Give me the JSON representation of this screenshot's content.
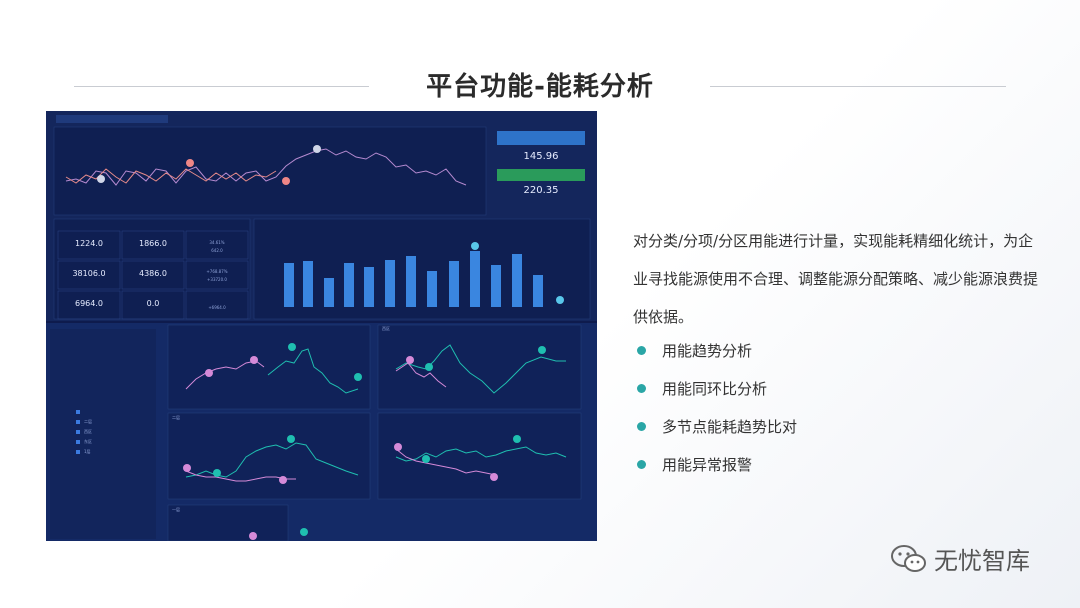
{
  "page": {
    "title": "平台功能-能耗分析"
  },
  "description": "对分类/分项/分区用能进行计量，实现能耗精细化统计，为企业寻找能源使用不合理、调整能源分配策略、减少能源浪费提供依据。",
  "bullets": [
    {
      "label": "用能趋势分析"
    },
    {
      "label": "用能同环比分析"
    },
    {
      "label": "多节点能耗趋势比对"
    },
    {
      "label": "用能异常报警"
    }
  ],
  "brand": {
    "label": "无忧智库"
  },
  "screenshot": {
    "side_values": [
      "145.96",
      "220.35"
    ],
    "kpis": [
      {
        "value": "1224.0"
      },
      {
        "value": "1866.0"
      },
      {
        "value": "34.61%"
      },
      {
        "value": "38106.0"
      },
      {
        "value": "4386.0"
      },
      {
        "value": "+768.87%"
      },
      {
        "value": "6964.0"
      },
      {
        "value": "0.0"
      },
      {
        "value": "+6964.0"
      }
    ],
    "kpi_sub": [
      "642.0",
      "+33720.0"
    ],
    "panel_titles": [
      "西区",
      "二层",
      "一层"
    ],
    "tree_items": [
      "二层",
      "西区",
      "东区",
      "1层"
    ],
    "colors": {
      "bg": "#0e1b4d",
      "bar": "#3a86e0",
      "teal": "#1fbfb0",
      "pink": "#d58ad8"
    }
  }
}
